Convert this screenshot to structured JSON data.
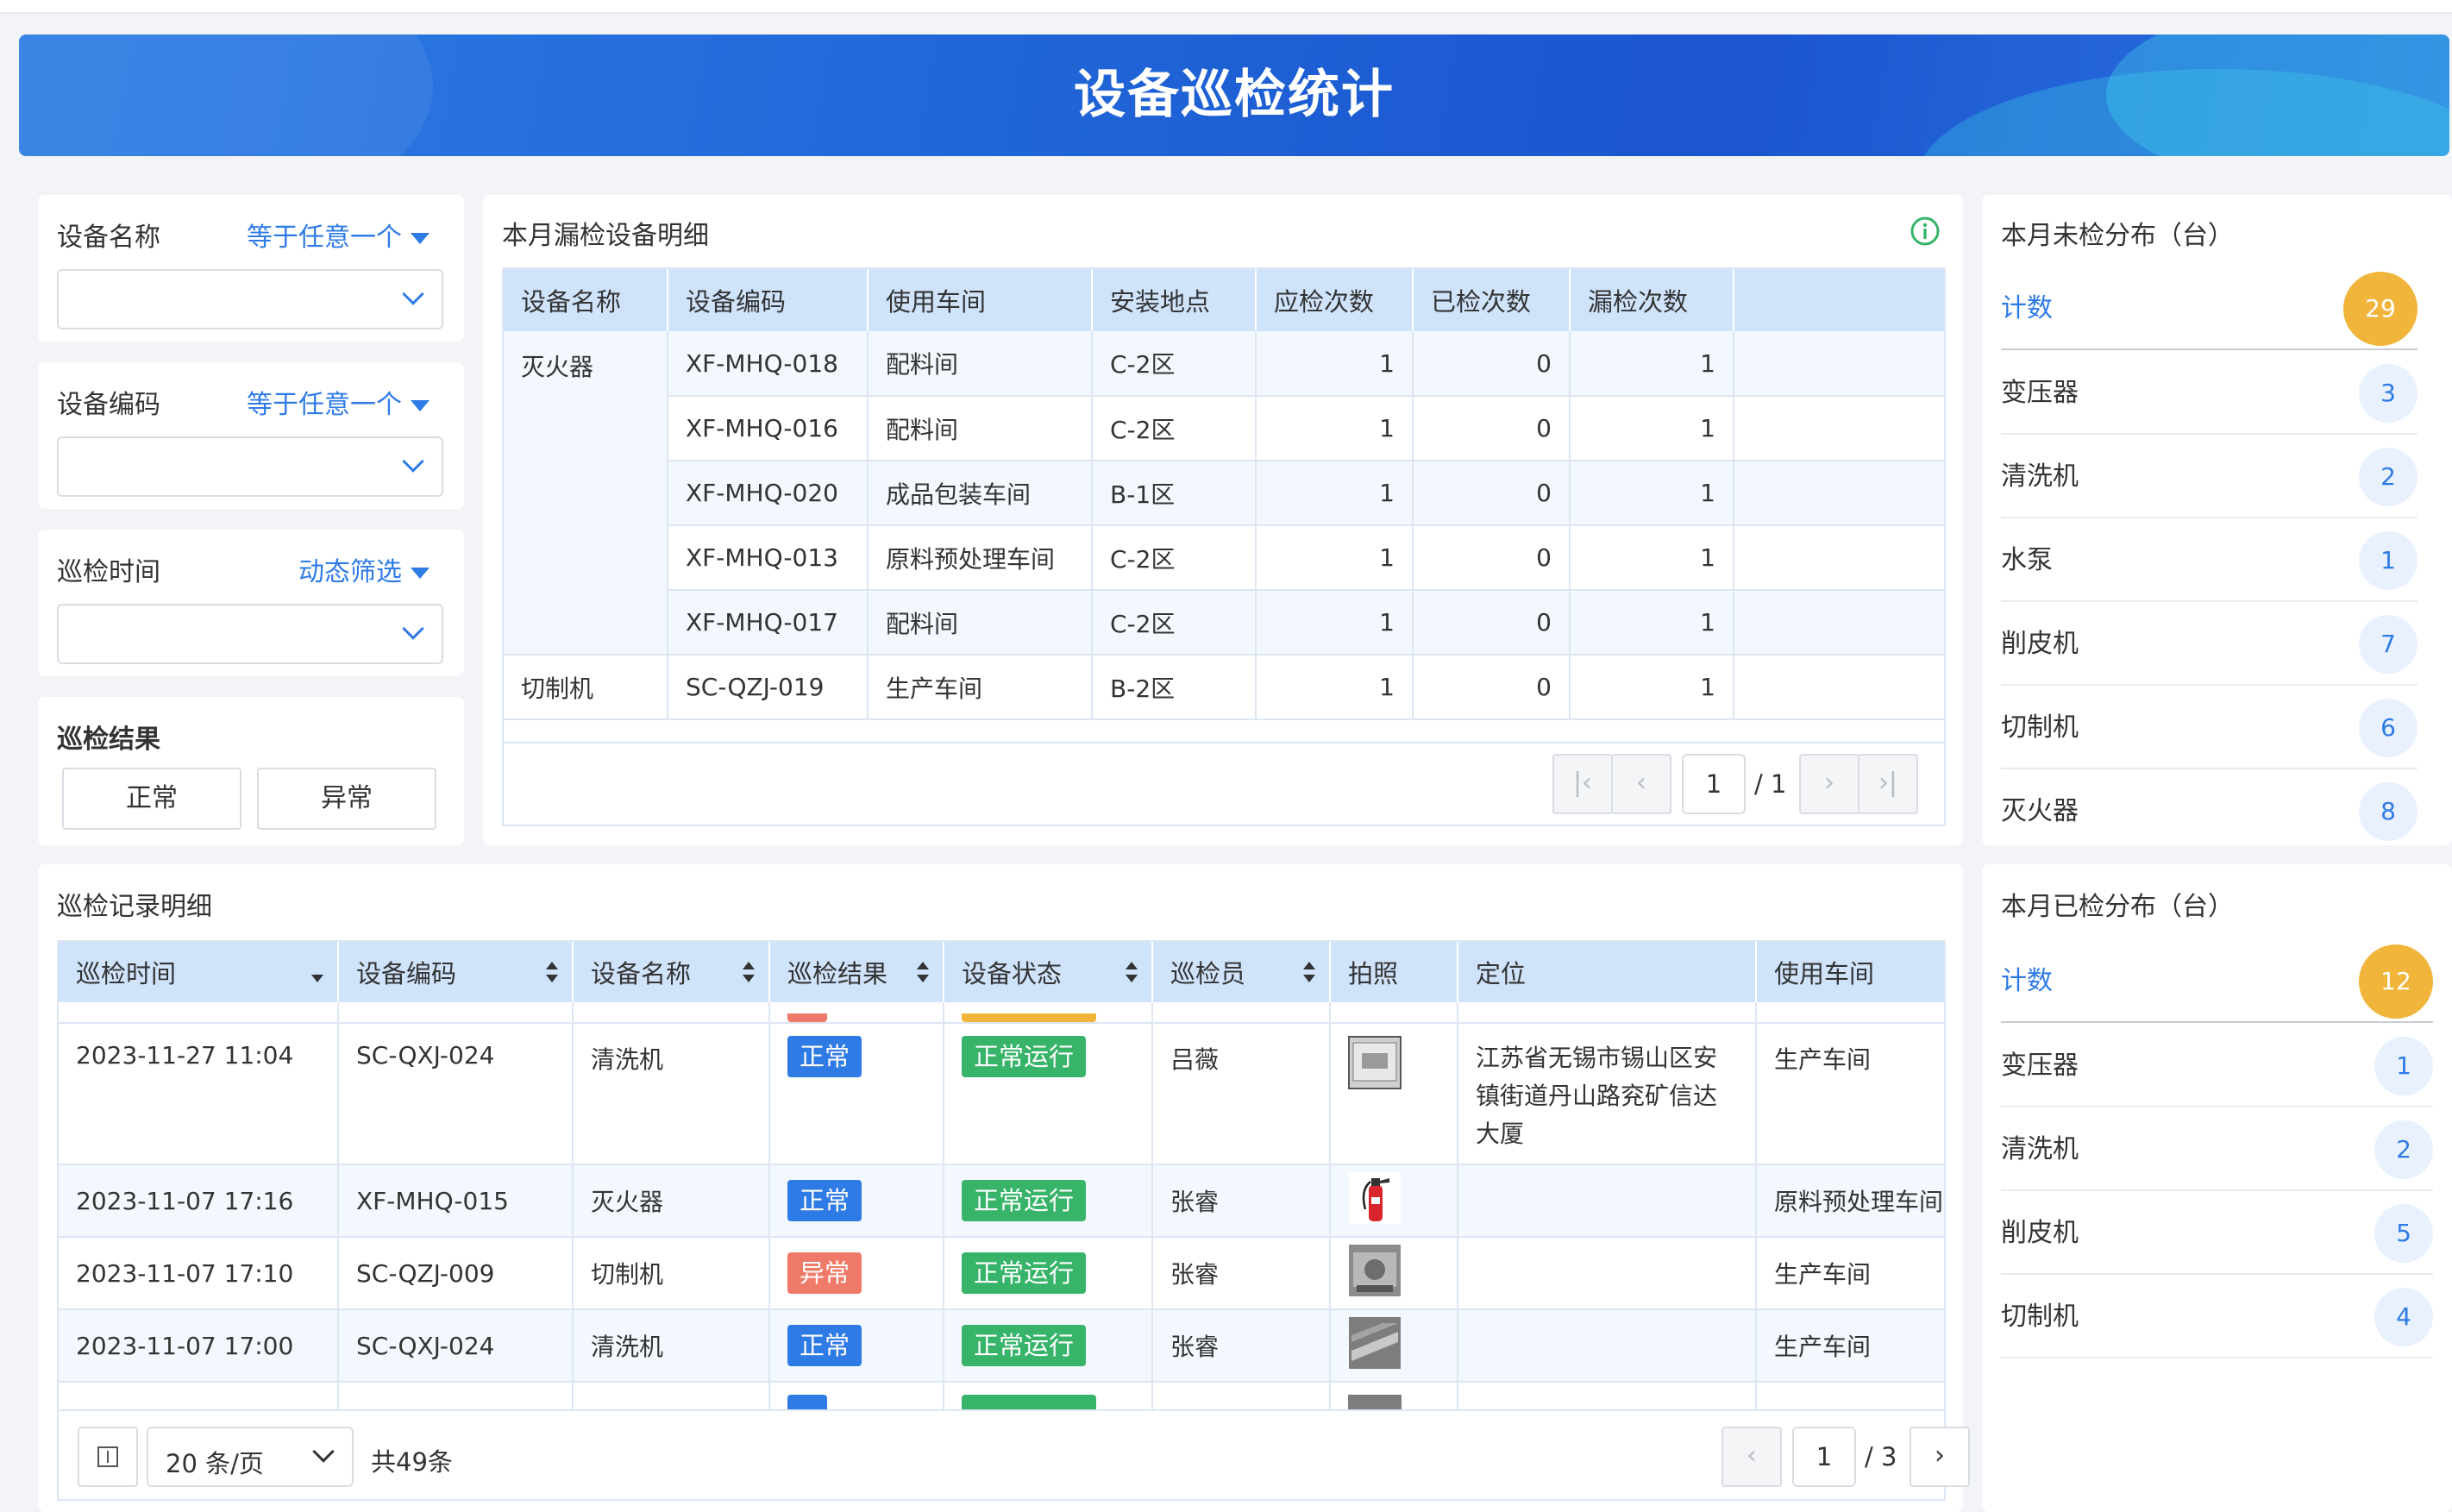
{
  "title": "设备巡检统计",
  "filters": [
    {
      "label": "设备名称",
      "op": "等于任意一个"
    },
    {
      "label": "设备编码",
      "op": "等于任意一个"
    },
    {
      "label": "巡检时间",
      "op": "动态筛选"
    }
  ],
  "result_filter": {
    "label": "巡检结果",
    "normal": "正常",
    "abnormal": "异常"
  },
  "missed": {
    "title": "本月漏检设备明细",
    "columns": [
      "设备名称",
      "设备编码",
      "使用车间",
      "安装地点",
      "应检次数",
      "已检次数",
      "漏检次数"
    ],
    "rows": [
      {
        "name": "灭火器",
        "code": "XF-MHQ-018",
        "shop": "配料间",
        "loc": "C-2区",
        "should": "1",
        "done": "0",
        "missed": "1"
      },
      {
        "name": "",
        "code": "XF-MHQ-016",
        "shop": "配料间",
        "loc": "C-2区",
        "should": "1",
        "done": "0",
        "missed": "1"
      },
      {
        "name": "",
        "code": "XF-MHQ-020",
        "shop": "成品包装车间",
        "loc": "B-1区",
        "should": "1",
        "done": "0",
        "missed": "1"
      },
      {
        "name": "",
        "code": "XF-MHQ-013",
        "shop": "原料预处理车间",
        "loc": "C-2区",
        "should": "1",
        "done": "0",
        "missed": "1"
      },
      {
        "name": "",
        "code": "XF-MHQ-017",
        "shop": "配料间",
        "loc": "C-2区",
        "should": "1",
        "done": "0",
        "missed": "1"
      },
      {
        "name": "切制机",
        "code": "SC-QZJ-019",
        "shop": "生产车间",
        "loc": "B-2区",
        "should": "1",
        "done": "0",
        "missed": "1"
      }
    ],
    "pager": {
      "page": "1",
      "total": "/ 1"
    }
  },
  "unchecked": {
    "title": "本月未检分布（台）",
    "head": {
      "label": "计数",
      "value": "29"
    },
    "items": [
      {
        "label": "变压器",
        "value": "3"
      },
      {
        "label": "清洗机",
        "value": "2"
      },
      {
        "label": "水泵",
        "value": "1"
      },
      {
        "label": "削皮机",
        "value": "7"
      },
      {
        "label": "切制机",
        "value": "6"
      },
      {
        "label": "灭火器",
        "value": "8"
      }
    ]
  },
  "records": {
    "title": "巡检记录明细",
    "columns": [
      "巡检时间",
      "设备编码",
      "设备名称",
      "巡检结果",
      "设备状态",
      "巡检员",
      "拍照",
      "定位",
      "使用车间"
    ],
    "rows": [
      {
        "time": "2023-11-27 11:04",
        "code": "SC-QXJ-024",
        "name": "清洗机",
        "result": "正常",
        "status": "正常运行",
        "inspector": "吕薇",
        "photo": "photo-box",
        "loc": "江苏省无锡市锡山区安镇街道丹山路兖矿信达大厦",
        "shop": "生产车间"
      },
      {
        "time": "2023-11-07 17:16",
        "code": "XF-MHQ-015",
        "name": "灭火器",
        "result": "正常",
        "status": "正常运行",
        "inspector": "张睿",
        "photo": "photo-extinguisher",
        "loc": "",
        "shop": "原料预处理车间"
      },
      {
        "time": "2023-11-07 17:10",
        "code": "SC-QZJ-009",
        "name": "切制机",
        "result": "异常",
        "status": "正常运行",
        "inspector": "张睿",
        "photo": "photo-machine",
        "loc": "",
        "shop": "生产车间"
      },
      {
        "time": "2023-11-07 17:00",
        "code": "SC-QXJ-024",
        "name": "清洗机",
        "result": "正常",
        "status": "正常运行",
        "inspector": "张睿",
        "photo": "photo-machine",
        "loc": "",
        "shop": "生产车间"
      }
    ],
    "page_size": "20 条/页",
    "total": "共49条",
    "pager": {
      "page": "1",
      "total": "/ 3"
    }
  },
  "checked": {
    "title": "本月已检分布（台）",
    "head": {
      "label": "计数",
      "value": "12"
    },
    "items": [
      {
        "label": "变压器",
        "value": "1"
      },
      {
        "label": "清洗机",
        "value": "2"
      },
      {
        "label": "削皮机",
        "value": "5"
      },
      {
        "label": "切制机",
        "value": "4"
      }
    ]
  },
  "colors": {
    "primary": "#2f7be6",
    "header_bg": "#cfe3fb",
    "normal": "#2f7be6",
    "abnormal": "#f07a6a",
    "running": "#37b46a",
    "badge": "#f0b53a"
  }
}
